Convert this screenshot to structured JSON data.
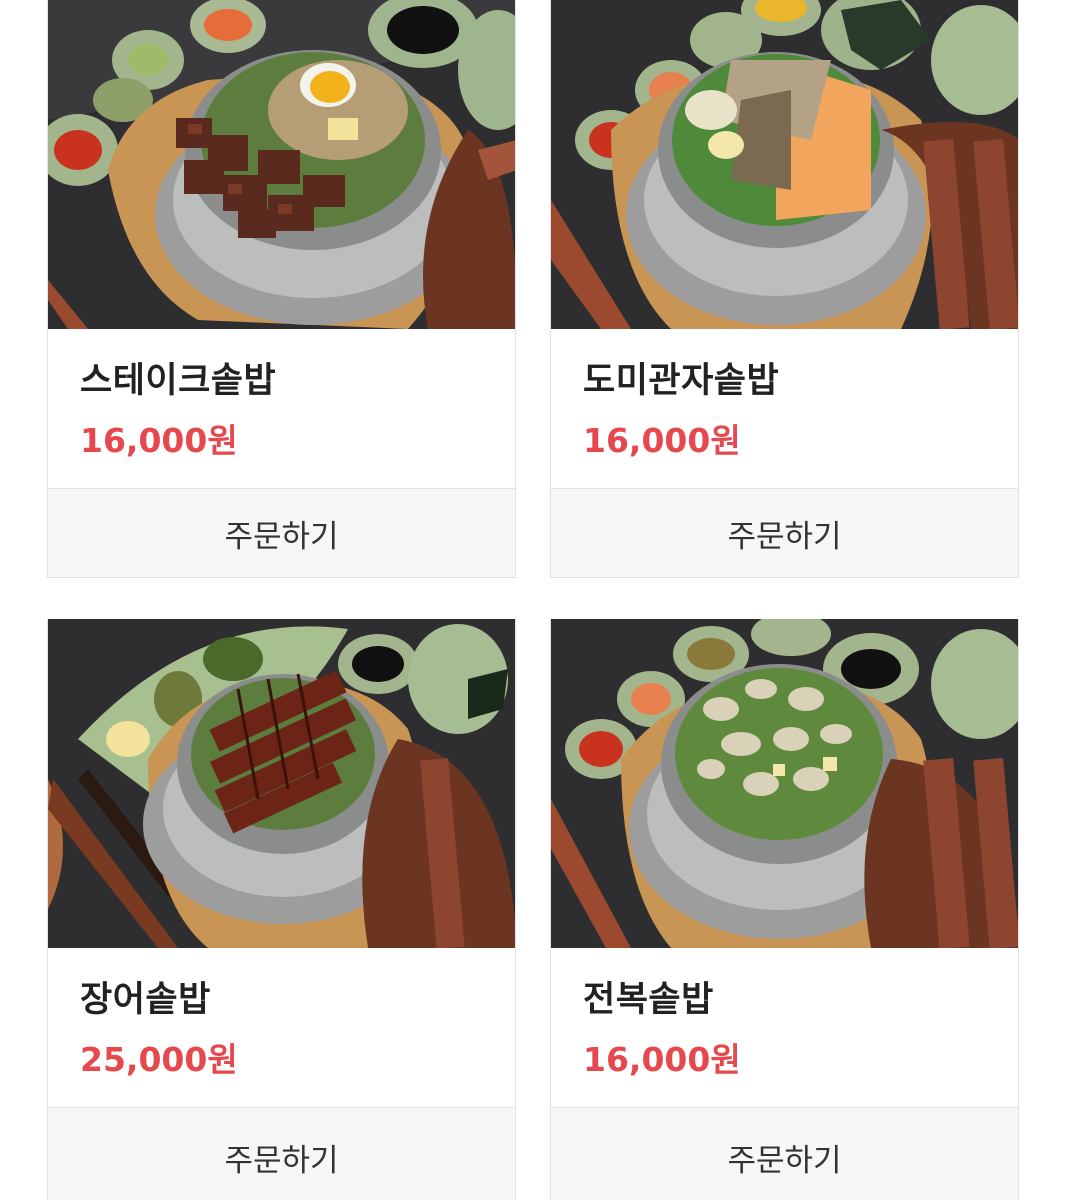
{
  "menu": {
    "items": [
      {
        "name": "스테이크솥밥",
        "price": "16,000원",
        "order_label": "주문하기",
        "photo": "steak-rice-pot-photo"
      },
      {
        "name": "도미관자솥밥",
        "price": "16,000원",
        "order_label": "주문하기",
        "photo": "sea-bream-scallop-rice-pot-photo"
      },
      {
        "name": "장어솥밥",
        "price": "25,000원",
        "order_label": "주문하기",
        "photo": "eel-rice-pot-photo"
      },
      {
        "name": "전복솥밥",
        "price": "16,000원",
        "order_label": "주문하기",
        "photo": "abalone-rice-pot-photo"
      }
    ]
  },
  "colors": {
    "price": "#e5484d",
    "button_bg": "#f6f7f9",
    "border": "#dfe2e6",
    "name": "#222222"
  }
}
